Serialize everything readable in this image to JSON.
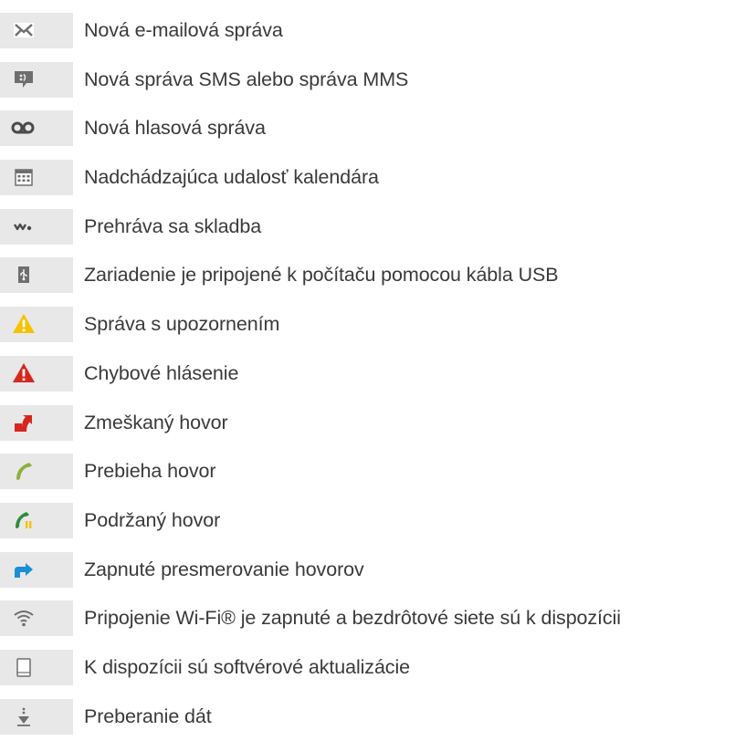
{
  "items": [
    {
      "icon": "email-icon",
      "label": "Nová e-mailová správa"
    },
    {
      "icon": "sms-mms-icon",
      "label": "Nová správa SMS alebo správa MMS"
    },
    {
      "icon": "voicemail-icon",
      "label": "Nová hlasová správa"
    },
    {
      "icon": "calendar-icon",
      "label": "Nadchádzajúca udalosť kalendára"
    },
    {
      "icon": "walkman-icon",
      "label": "Prehráva sa skladba"
    },
    {
      "icon": "usb-icon",
      "label": "Zariadenie je pripojené k počítaču pomocou kábla USB"
    },
    {
      "icon": "warning-icon",
      "label": "Správa s upozornením"
    },
    {
      "icon": "error-icon",
      "label": "Chybové hlásenie"
    },
    {
      "icon": "missed-call-icon",
      "label": "Zmeškaný hovor"
    },
    {
      "icon": "call-in-progress-icon",
      "label": "Prebieha hovor"
    },
    {
      "icon": "call-on-hold-icon",
      "label": "Podržaný hovor"
    },
    {
      "icon": "call-forwarding-icon",
      "label": "Zapnuté presmerovanie hovorov"
    },
    {
      "icon": "wifi-icon",
      "label": "Pripojenie Wi-Fi® je zapnuté a bezdrôtové siete sú k dispozícii"
    },
    {
      "icon": "software-update-icon",
      "label": "K dispozícii sú softvérové aktualizácie"
    },
    {
      "icon": "download-icon",
      "label": "Preberanie dát"
    }
  ],
  "colors": {
    "icon_background": "#e8e8e8",
    "text": "#3a3a3a",
    "icon_gray": "#7a7a7a",
    "warning_yellow": "#f6c200",
    "error_red": "#d7261e",
    "call_green": "#8fae3f",
    "hold_green": "#2e8b3a",
    "forward_blue": "#1b8fd6"
  }
}
